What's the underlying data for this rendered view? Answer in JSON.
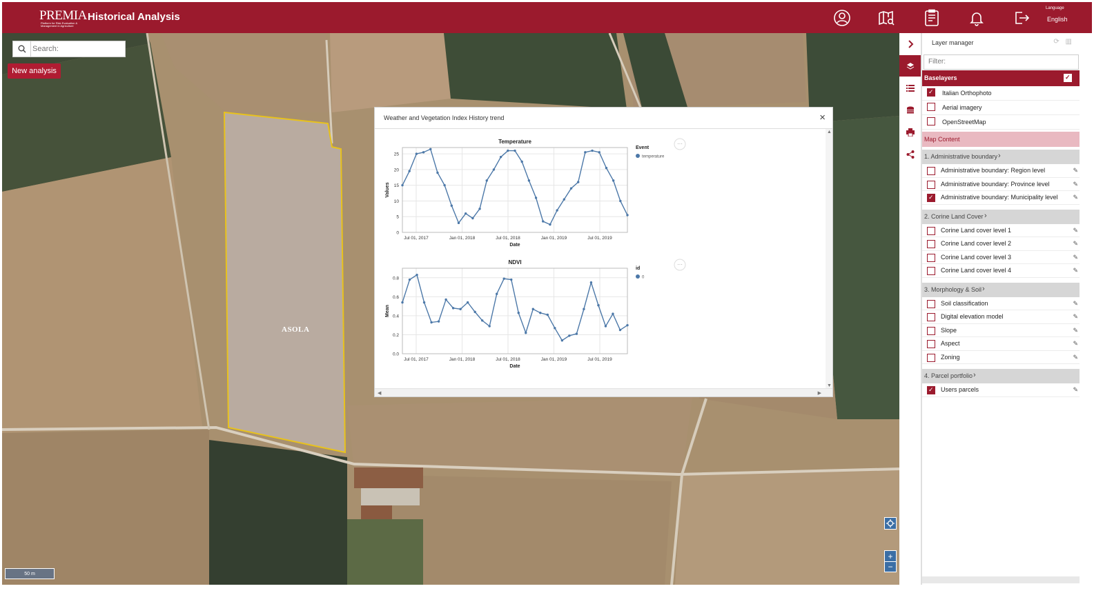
{
  "header": {
    "logo_text": "PREMIA",
    "logo_tagline": "Platform for Risk Evaluation & Management in Agriculture",
    "title": "Historical Analysis",
    "language_label": "Language",
    "language_value": "English",
    "icons": [
      "user-circle-icon",
      "map-search-icon",
      "report-icon",
      "bell-icon",
      "logout-icon"
    ]
  },
  "map": {
    "search_placeholder": "Search:",
    "new_analysis_label": "New analysis",
    "field_label": "ASOLA",
    "scale_label": "50 m",
    "zoom_in": "+",
    "zoom_out": "−"
  },
  "dialog": {
    "title": "Weather and Vegetation Index History trend",
    "close": "×"
  },
  "chart_data": [
    {
      "type": "line",
      "title": "Temperature",
      "xlabel": "Date",
      "ylabel": "Values",
      "legend_title": "Event",
      "xticks": [
        "Jul 01, 2017",
        "Jan 01, 2018",
        "Jul 01, 2018",
        "Jan 01, 2019",
        "Jul 01, 2019"
      ],
      "yticks": [
        "0",
        "5",
        "10",
        "15",
        "20",
        "25"
      ],
      "ylim": [
        0,
        27
      ],
      "color": "#4c78a8",
      "series": [
        {
          "name": "temperature",
          "values": [
            15,
            19.5,
            25,
            25.5,
            26.5,
            19,
            15,
            8.5,
            3,
            6,
            4.5,
            7.5,
            16.5,
            20,
            24,
            26,
            26,
            22.5,
            16.5,
            11,
            3.5,
            2.5,
            7,
            10.5,
            14,
            16,
            25.5,
            26,
            25.5,
            20.5,
            16.5,
            10,
            5.5
          ]
        }
      ]
    },
    {
      "type": "line",
      "title": "NDVI",
      "xlabel": "Date",
      "ylabel": "Mean",
      "legend_title": "id",
      "xticks": [
        "Jul 01, 2017",
        "Jan 01, 2018",
        "Jul 01, 2018",
        "Jan 01, 2019",
        "Jul 01, 2019"
      ],
      "yticks": [
        "0.0",
        "0.2",
        "0.4",
        "0.6",
        "0.8"
      ],
      "ylim": [
        0,
        0.9
      ],
      "color": "#4c78a8",
      "series": [
        {
          "name": "0",
          "values": [
            0.54,
            0.78,
            0.83,
            0.54,
            0.33,
            0.34,
            0.57,
            0.48,
            0.47,
            0.54,
            0.44,
            0.35,
            0.29,
            0.63,
            0.79,
            0.78,
            0.43,
            0.22,
            0.47,
            0.43,
            0.41,
            0.27,
            0.14,
            0.19,
            0.21,
            0.47,
            0.75,
            0.51,
            0.29,
            0.42,
            0.25,
            0.3
          ]
        }
      ]
    }
  ],
  "rail": {
    "icons": [
      "chevron-right-icon",
      "layers-icon",
      "list-icon",
      "database-icon",
      "print-icon",
      "share-icon"
    ]
  },
  "panel": {
    "title": "Layer manager",
    "filter_placeholder": "Filter:",
    "baselayers_label": "Baselayers",
    "baselayers": [
      {
        "label": "Italian Orthophoto",
        "checked": true
      },
      {
        "label": "Aerial imagery",
        "checked": false
      },
      {
        "label": "OpenStreetMap",
        "checked": false
      }
    ],
    "map_content_label": "Map Content",
    "groups": [
      {
        "label": "1. Administrative boundary",
        "items": [
          {
            "label": "Administrative boundary: Region level",
            "checked": false
          },
          {
            "label": "Administrative boundary: Province level",
            "checked": false
          },
          {
            "label": "Administrative boundary: Municipality level",
            "checked": true
          }
        ]
      },
      {
        "label": "2. Corine Land Cover",
        "items": [
          {
            "label": "Corine Land cover level 1",
            "checked": false
          },
          {
            "label": "Corine Land cover level 2",
            "checked": false
          },
          {
            "label": "Corine Land cover level 3",
            "checked": false
          },
          {
            "label": "Corine Land cover level 4",
            "checked": false
          }
        ]
      },
      {
        "label": "3. Morphology & Soil",
        "items": [
          {
            "label": "Soil classification",
            "checked": false
          },
          {
            "label": "Digital elevation model",
            "checked": false
          },
          {
            "label": "Slope",
            "checked": false
          },
          {
            "label": "Aspect",
            "checked": false
          },
          {
            "label": "Zoning",
            "checked": false
          }
        ]
      },
      {
        "label": "4. Parcel portfolio",
        "items": [
          {
            "label": "Users parcels",
            "checked": true
          }
        ]
      }
    ]
  }
}
